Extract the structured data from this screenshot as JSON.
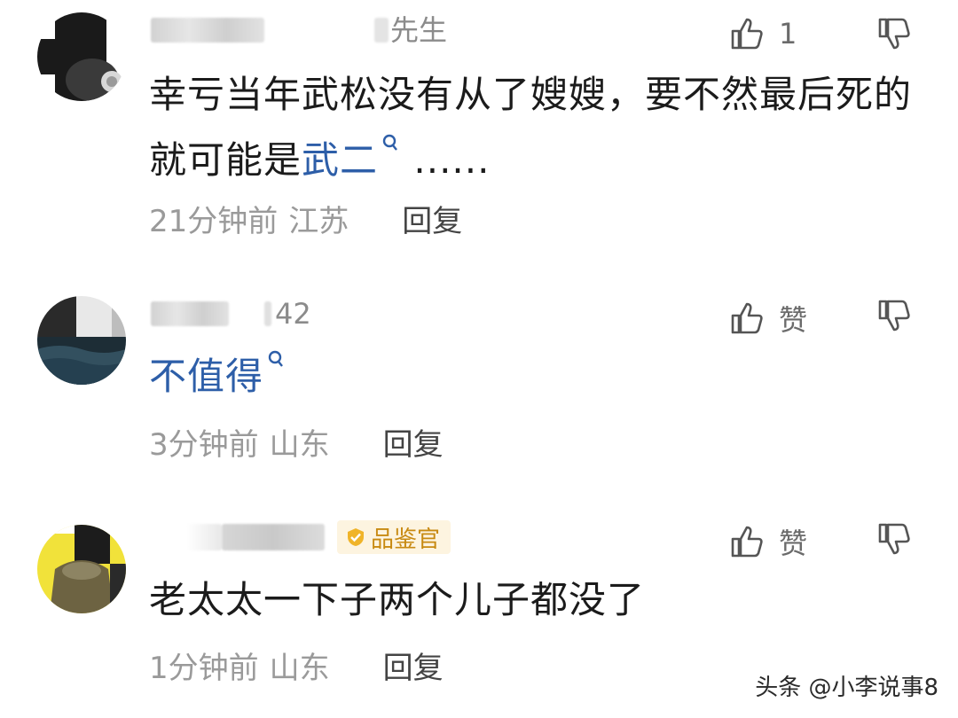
{
  "comments": [
    {
      "name_suffix": "先生",
      "badge": "",
      "like_count": "1",
      "content_parts": [
        "幸亏当年武松没有从了嫂嫂，要不然最后死的就可能是",
        "武二",
        " ......"
      ],
      "time": "21分钟前",
      "location": "江苏",
      "reply_label": "回复"
    },
    {
      "name_suffix": "42",
      "badge": "",
      "like_count": "赞",
      "content_parts": [
        "",
        "不值得",
        ""
      ],
      "time": "3分钟前",
      "location": "山东",
      "reply_label": "回复"
    },
    {
      "name_suffix": "",
      "badge": "品鉴官",
      "like_count": "赞",
      "content_parts": [
        "老太太一下子两个儿子都没了",
        "",
        ""
      ],
      "time": "1分钟前",
      "location": "山东",
      "reply_label": "回复"
    }
  ],
  "watermark": "头条 @小李说事8",
  "colors": {
    "link": "#2d5ea8",
    "meta": "#9a9a9a",
    "badge_bg": "#fdf4e0",
    "badge_text": "#c88a12"
  },
  "icons": [
    "thumbs-up-icon",
    "thumbs-down-icon",
    "search-icon",
    "badge-check-icon"
  ]
}
